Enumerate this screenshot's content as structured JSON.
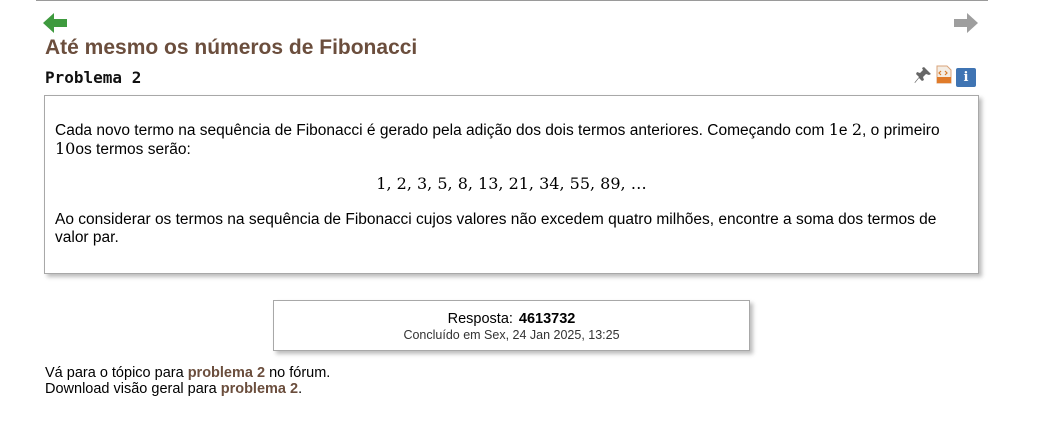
{
  "nav": {
    "prev_icon": "arrow-left-icon",
    "next_icon": "arrow-right-icon",
    "prev_color": "#3e9a3e",
    "next_color": "#9e9e9e"
  },
  "problem": {
    "title": "Até mesmo os números de Fibonacci",
    "label": "Problema 2"
  },
  "tools": {
    "pin_icon": "pin-icon",
    "html_icon": "html-icon",
    "info_icon": "info-icon",
    "info_label": "i"
  },
  "content": {
    "p1_a": "Cada novo termo na sequência de Fibonacci é gerado pela adição dos dois termos anteriores. Começando com ",
    "p1_one": "1",
    "p1_b": "e ",
    "p1_two": "2",
    "p1_c": ", o primeiro ",
    "p1_ten": "10",
    "p1_d": "os termos serão:",
    "sequence": "1, 2, 3, 5, 8, 13, 21, 34, 55, 89, …",
    "p2": "Ao considerar os termos na sequência de Fibonacci cujos valores não excedem quatro milhões, encontre a soma dos termos de valor par."
  },
  "answer": {
    "label": "Resposta:",
    "value": "4613732",
    "completed": "Concluído em Sex, 24 Jan 2025, 13:25"
  },
  "footer": {
    "line1_a": "Vá para o tópico para ",
    "line1_link": "problema 2",
    "line1_b": " no fórum.",
    "line2_a": "Download visão geral para ",
    "line2_link": "problema 2",
    "line2_b": "."
  },
  "colors": {
    "accent": "#6b4e3d",
    "info_button": "#3f74b3"
  }
}
